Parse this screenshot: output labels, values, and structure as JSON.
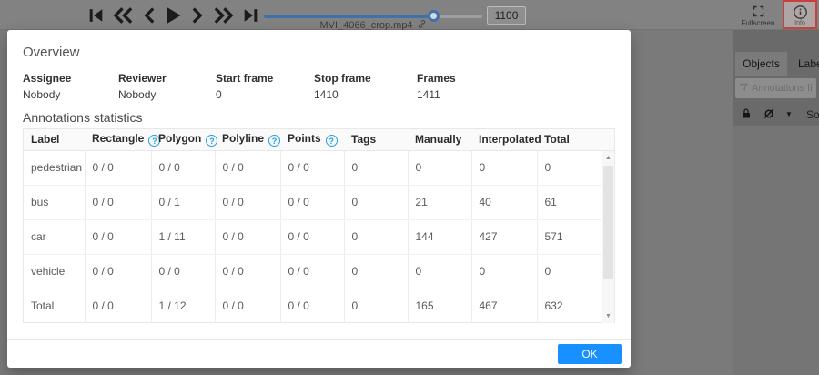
{
  "player": {
    "filename": "MVI_4066_crop.mp4",
    "frame_value": "1100",
    "slider": {
      "min": 0,
      "max": 1410,
      "value": 1100,
      "percent": 78
    }
  },
  "topbar": {
    "fullscreen_label": "Fullscreen",
    "info_label": "Info"
  },
  "sidebar": {
    "tabs": [
      {
        "label": "Objects",
        "active": true
      },
      {
        "label": "Labels",
        "active": false
      }
    ],
    "filter_placeholder": "Annotations filter",
    "sort_label": "Sort"
  },
  "modal": {
    "overview_title": "Overview",
    "fields": [
      {
        "label": "Assignee",
        "value": "Nobody"
      },
      {
        "label": "Reviewer",
        "value": "Nobody"
      },
      {
        "label": "Start frame",
        "value": "0"
      },
      {
        "label": "Stop frame",
        "value": "1410"
      },
      {
        "label": "Frames",
        "value": "1411"
      }
    ],
    "stats_title": "Annotations statistics",
    "table": {
      "headers": [
        "Label",
        "Rectangle",
        "Polygon",
        "Polyline",
        "Points",
        "Tags",
        "Manually",
        "Interpolated",
        "Total"
      ],
      "help_columns": [
        1,
        2,
        3,
        4
      ],
      "help_char": "?",
      "rows": [
        [
          "pedestrian",
          "0 / 0",
          "0 / 0",
          "0 / 0",
          "0 / 0",
          "0",
          "0",
          "0",
          "0"
        ],
        [
          "bus",
          "0 / 0",
          "0 / 1",
          "0 / 0",
          "0 / 0",
          "0",
          "21",
          "40",
          "61"
        ],
        [
          "car",
          "0 / 0",
          "1 / 11",
          "0 / 0",
          "0 / 0",
          "0",
          "144",
          "427",
          "571"
        ],
        [
          "vehicle",
          "0 / 0",
          "0 / 0",
          "0 / 0",
          "0 / 0",
          "0",
          "0",
          "0",
          "0"
        ],
        [
          "Total",
          "0 / 0",
          "1 / 12",
          "0 / 0",
          "0 / 0",
          "0",
          "165",
          "467",
          "632"
        ]
      ]
    },
    "ok_label": "OK"
  },
  "icons": {
    "caret_down": "▼",
    "scroll_up": "▲",
    "scroll_down": "▼",
    "names": [
      "first-frame-icon",
      "backward-icon",
      "previous-icon",
      "play-icon",
      "next-icon",
      "forward-icon",
      "last-frame-icon",
      "link-icon",
      "fullscreen-icon",
      "info-icon",
      "filter-funnel-icon",
      "lock-icon",
      "hidden-eye-icon",
      "caret-down-icon",
      "help-icon",
      "scroll-up-icon",
      "scroll-down-icon"
    ]
  },
  "colors": {
    "accent": "#1890ff",
    "help_blue": "#2e9bdc",
    "info_highlight_border": "#c9403c",
    "slider_blue_dimmed": "#3f72ad"
  }
}
